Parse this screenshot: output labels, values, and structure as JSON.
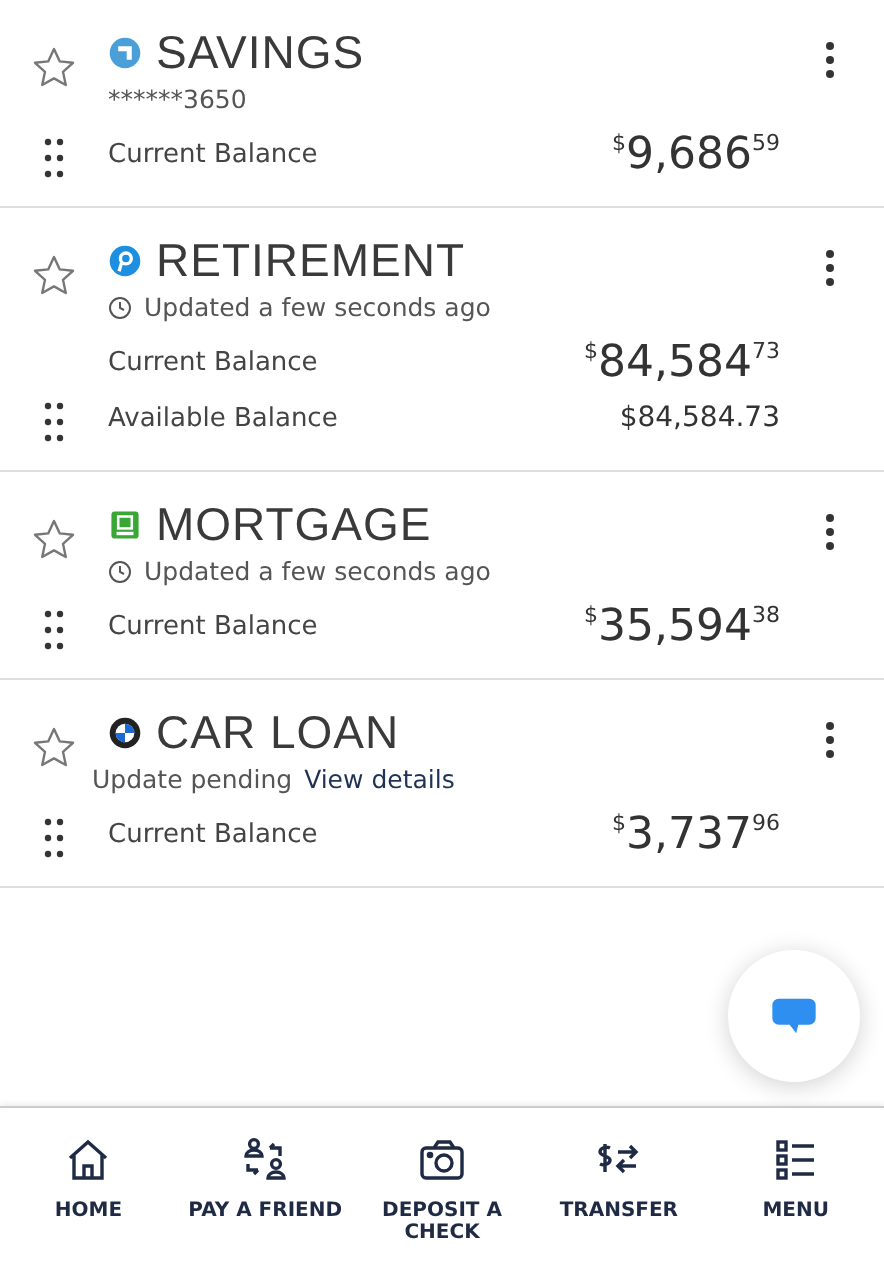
{
  "accounts": [
    {
      "name": "SAVINGS",
      "starred": false,
      "status": {
        "kind": "number",
        "text": "******3650"
      },
      "balances": [
        {
          "kind": "big",
          "label": "Current Balance",
          "currency": "$",
          "whole": "9,686",
          "cents": "59"
        }
      ]
    },
    {
      "name": "RETIREMENT",
      "starred": false,
      "status": {
        "kind": "updated",
        "text": "Updated a few seconds ago"
      },
      "balances": [
        {
          "kind": "big",
          "label": "Current Balance",
          "currency": "$",
          "whole": "84,584",
          "cents": "73"
        },
        {
          "kind": "plain",
          "label": "Available Balance",
          "amount": "$84,584.73"
        }
      ]
    },
    {
      "name": "MORTGAGE",
      "starred": false,
      "status": {
        "kind": "updated",
        "text": "Updated a few seconds ago"
      },
      "balances": [
        {
          "kind": "big",
          "label": "Current Balance",
          "currency": "$",
          "whole": "35,594",
          "cents": "38"
        }
      ]
    },
    {
      "name": "CAR LOAN",
      "starred": false,
      "status": {
        "kind": "pending",
        "text": "Update pending",
        "link": "View details"
      },
      "balances": [
        {
          "kind": "big",
          "label": "Current Balance",
          "currency": "$",
          "whole": "3,737",
          "cents": "96"
        }
      ]
    }
  ],
  "nav": [
    {
      "label": "HOME"
    },
    {
      "label": "PAY A FRIEND"
    },
    {
      "label": "DEPOSIT A CHECK"
    },
    {
      "label": "TRANSFER"
    },
    {
      "label": "MENU"
    }
  ]
}
